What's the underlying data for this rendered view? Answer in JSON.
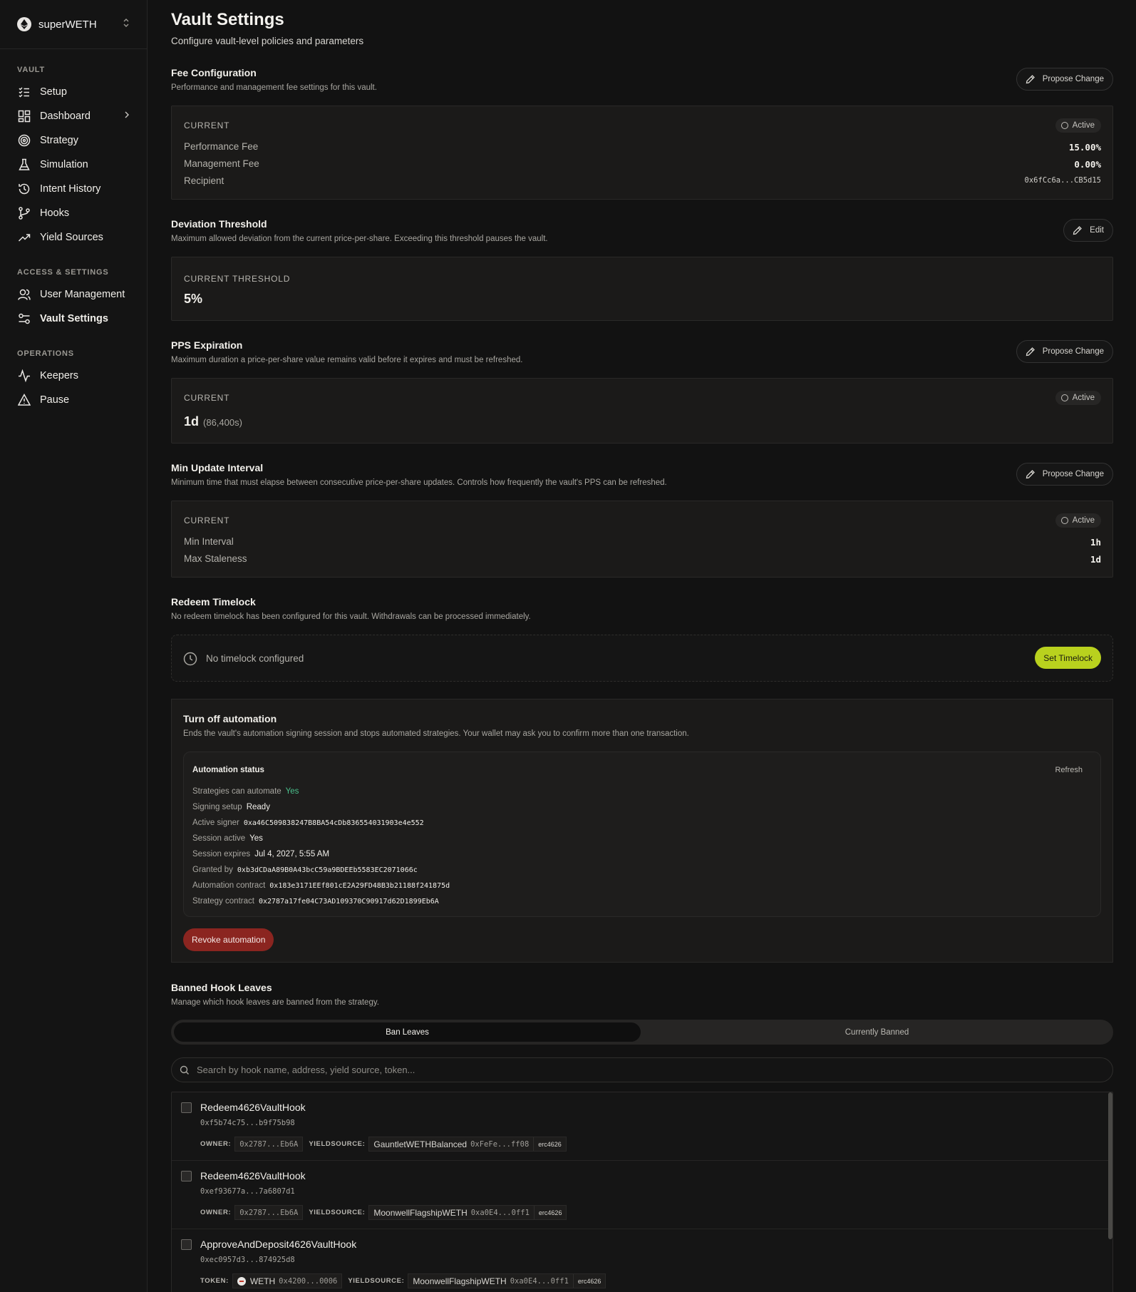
{
  "sidebar": {
    "vault_name": "superWETH",
    "sections": [
      {
        "label": "VAULT",
        "items": [
          {
            "label": "Setup",
            "icon": "list-check-icon"
          },
          {
            "label": "Dashboard",
            "icon": "grid-icon",
            "has_chevron": true
          },
          {
            "label": "Strategy",
            "icon": "target-icon"
          },
          {
            "label": "Simulation",
            "icon": "flask-icon"
          },
          {
            "label": "Intent History",
            "icon": "history-icon"
          },
          {
            "label": "Hooks",
            "icon": "git-branch-icon"
          },
          {
            "label": "Yield Sources",
            "icon": "trending-up-icon"
          }
        ]
      },
      {
        "label": "ACCESS & SETTINGS",
        "items": [
          {
            "label": "User Management",
            "icon": "users-icon"
          },
          {
            "label": "Vault Settings",
            "icon": "settings-sliders-icon",
            "active": true
          }
        ]
      },
      {
        "label": "OPERATIONS",
        "items": [
          {
            "label": "Keepers",
            "icon": "activity-icon"
          },
          {
            "label": "Pause",
            "icon": "warning-icon"
          }
        ]
      }
    ]
  },
  "page": {
    "title": "Vault Settings",
    "subtitle": "Configure vault-level policies and parameters"
  },
  "fee": {
    "title": "Fee Configuration",
    "desc": "Performance and management fee settings for this vault.",
    "button": "Propose Change",
    "caption": "CURRENT",
    "badge": "Active",
    "rows": [
      {
        "label": "Performance Fee",
        "value": "15.00%"
      },
      {
        "label": "Management Fee",
        "value": "0.00%"
      },
      {
        "label": "Recipient",
        "value": "0x6fCc6a...CB5d15"
      }
    ]
  },
  "deviation": {
    "title": "Deviation Threshold",
    "desc": "Maximum allowed deviation from the current price-per-share. Exceeding this threshold pauses the vault.",
    "button": "Edit",
    "caption": "CURRENT THRESHOLD",
    "value": "5%"
  },
  "pps": {
    "title": "PPS Expiration",
    "desc": "Maximum duration a price-per-share value remains valid before it expires and must be refreshed.",
    "button": "Propose Change",
    "caption": "CURRENT",
    "badge": "Active",
    "value": "1d",
    "sub_value": "(86,400s)"
  },
  "min_update": {
    "title": "Min Update Interval",
    "desc": "Minimum time that must elapse between consecutive price-per-share updates. Controls how frequently the vault's PPS can be refreshed.",
    "button": "Propose Change",
    "caption": "CURRENT",
    "badge": "Active",
    "rows": [
      {
        "label": "Min Interval",
        "value": "1h"
      },
      {
        "label": "Max Staleness",
        "value": "1d"
      }
    ]
  },
  "timelock": {
    "title": "Redeem Timelock",
    "desc": "No redeem timelock has been configured for this vault. Withdrawals can be processed immediately.",
    "status": "No timelock configured",
    "button": "Set Timelock"
  },
  "automation": {
    "title": "Turn off automation",
    "desc": "Ends the vault's automation signing session and stops automated strategies. Your wallet may ask you to confirm more than one transaction.",
    "status_title": "Automation status",
    "refresh": "Refresh",
    "rows": [
      {
        "label": "Strategies can automate",
        "value": "Yes"
      },
      {
        "label": "Signing setup",
        "value": "Ready"
      },
      {
        "label": "Active signer",
        "value": "0xa46C509838247B8BA54cDb836554031903e4e552"
      },
      {
        "label": "Session active",
        "value": "Yes"
      },
      {
        "label": "Session expires",
        "value": "Jul 4, 2027, 5:55 AM"
      },
      {
        "label": "Granted by",
        "value": "0xb3dCDaA89B0A43bcC59a9BDEEb5583EC2071066c"
      },
      {
        "label": "Automation contract",
        "value": "0x183e3171EEf801cE2A29FD48B3b21188f241875d"
      },
      {
        "label": "Strategy contract",
        "value": "0x2787a17fe04C73AD109370C90917d62D1899Eb6A"
      }
    ],
    "revoke": "Revoke automation"
  },
  "banned": {
    "title": "Banned Hook Leaves",
    "desc": "Manage which hook leaves are banned from the strategy.",
    "tabs": [
      "Ban Leaves",
      "Currently Banned"
    ],
    "search_placeholder": "Search by hook name, address, yield source, token...",
    "hooks": [
      {
        "name": "Redeem4626VaultHook",
        "addr": "0xf5b74c75...b9f75b98",
        "k1": "OWNER:",
        "v1": "0x2787...Eb6A",
        "k2": "YIELDSOURCE:",
        "ys_name": "GauntletWETHBalanced",
        "ys_addr": "0xFeFe...ff08",
        "tag": "erc4626"
      },
      {
        "name": "Redeem4626VaultHook",
        "addr": "0xef93677a...7a6807d1",
        "k1": "OWNER:",
        "v1": "0x2787...Eb6A",
        "k2": "YIELDSOURCE:",
        "ys_name": "MoonwellFlagshipWETH",
        "ys_addr": "0xa0E4...0ff1",
        "tag": "erc4626"
      },
      {
        "name": "ApproveAndDeposit4626VaultHook",
        "addr": "0xec0957d3...874925d8",
        "k1": "TOKEN:",
        "token_name": "WETH",
        "v1": "0x4200...0006",
        "k2": "YIELDSOURCE:",
        "ys_name": "MoonwellFlagshipWETH",
        "ys_addr": "0xa0E4...0ff1",
        "tag": "erc4626"
      }
    ]
  }
}
